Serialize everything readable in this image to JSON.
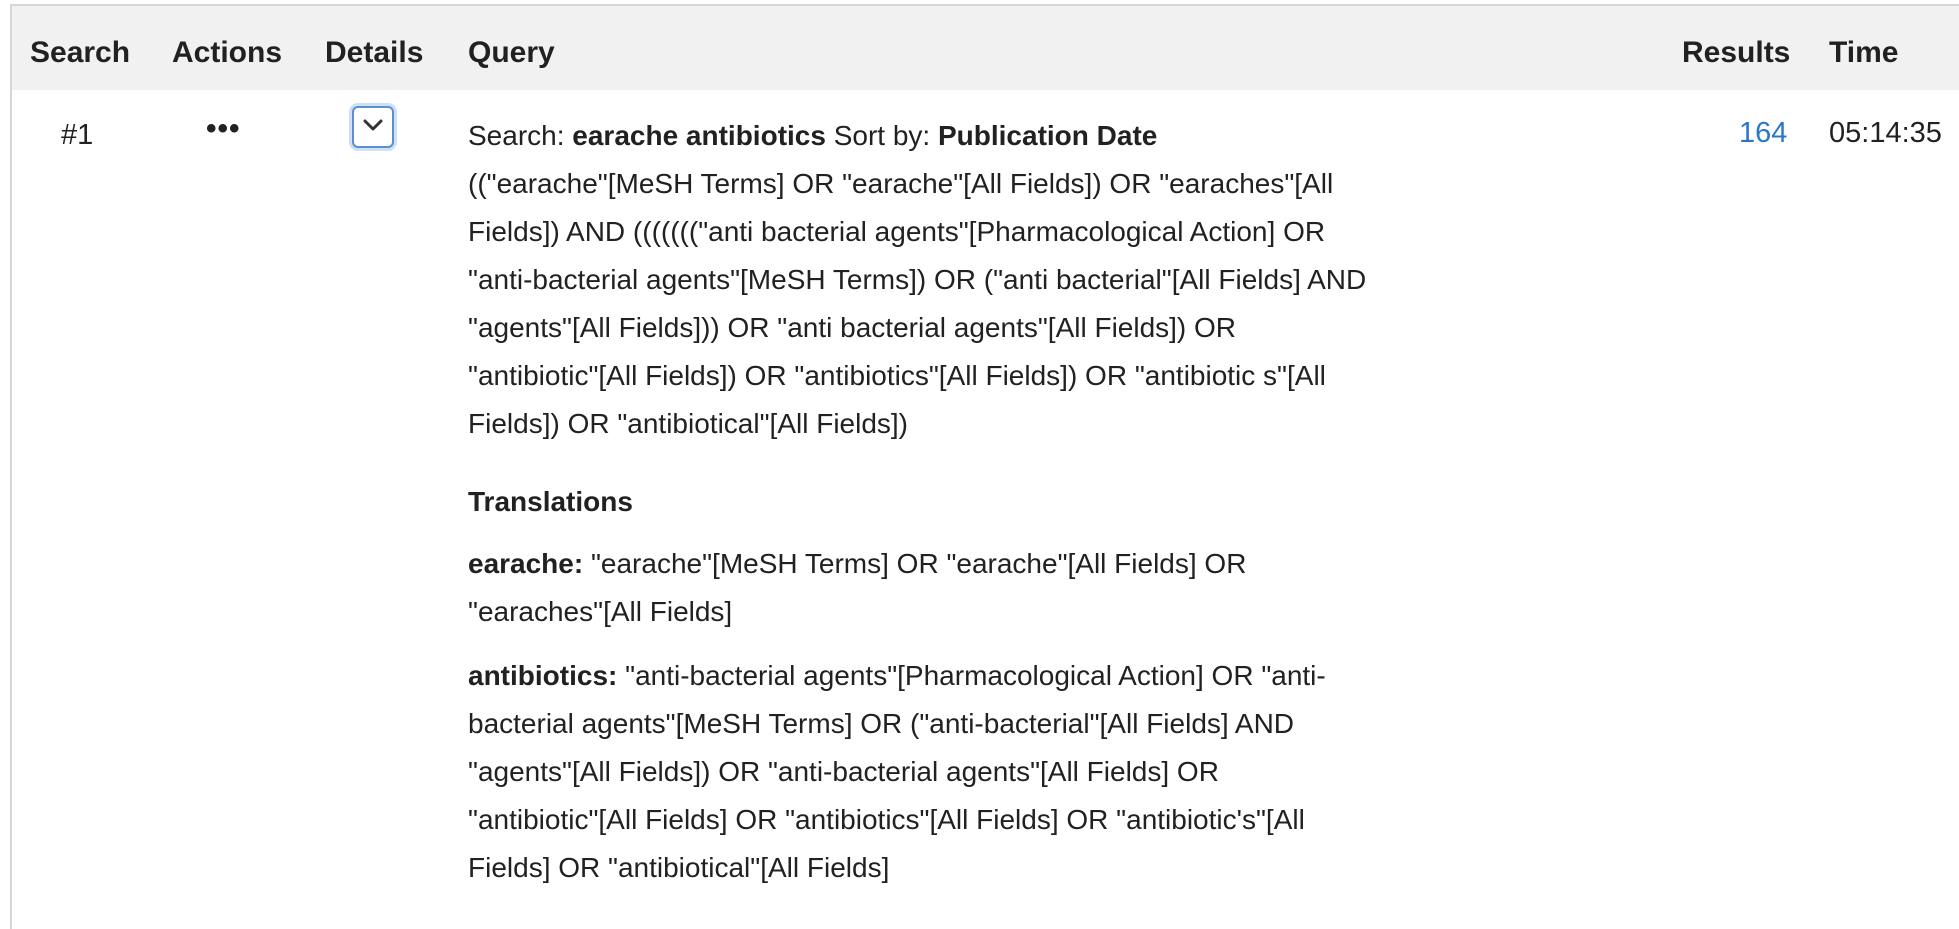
{
  "table": {
    "headers": {
      "search": "Search",
      "actions": "Actions",
      "details": "Details",
      "query": "Query",
      "results": "Results",
      "time": "Time"
    }
  },
  "row": {
    "search_number": "#1",
    "actions_label": "•••",
    "details_toggle_icon": "chevron-down-icon",
    "query": {
      "search_prefix": "Search:",
      "search_terms": "earache antibiotics",
      "sort_prefix": "Sort by:",
      "sort_value": "Publication Date",
      "details_lines": [
        "((\"earache\"[MeSH Terms] OR \"earache\"[All Fields]) OR \"earaches\"[All",
        "Fields]) AND (((((((\"anti bacterial agents\"[Pharmacological Action] OR",
        "\"anti-bacterial agents\"[MeSH Terms]) OR (\"anti bacterial\"[All Fields] AND",
        "\"agents\"[All Fields])) OR \"anti bacterial agents\"[All Fields]) OR",
        "\"antibiotic\"[All Fields]) OR \"antibiotics\"[All Fields]) OR \"antibiotic s\"[All",
        "Fields]) OR \"antibiotical\"[All Fields])"
      ],
      "translations_heading": "Translations",
      "translations": [
        {
          "term": "earache:",
          "lines": [
            "\"earache\"[MeSH Terms] OR \"earache\"[All Fields] OR",
            "\"earaches\"[All Fields]"
          ]
        },
        {
          "term": "antibiotics:",
          "lines": [
            "\"anti-bacterial agents\"[Pharmacological Action] OR \"anti-",
            "bacterial agents\"[MeSH Terms] OR (\"anti-bacterial\"[All Fields] AND",
            "\"agents\"[All Fields]) OR \"anti-bacterial agents\"[All Fields] OR",
            "\"antibiotic\"[All Fields] OR \"antibiotics\"[All Fields] OR \"antibiotic's\"[All",
            "Fields] OR \"antibiotical\"[All Fields]"
          ]
        }
      ]
    },
    "results": "164",
    "time": "05:14:35"
  },
  "colors": {
    "header_bg": "#f1f1f1",
    "link": "#2a77c9",
    "details_button_border": "#5b8fcf"
  }
}
